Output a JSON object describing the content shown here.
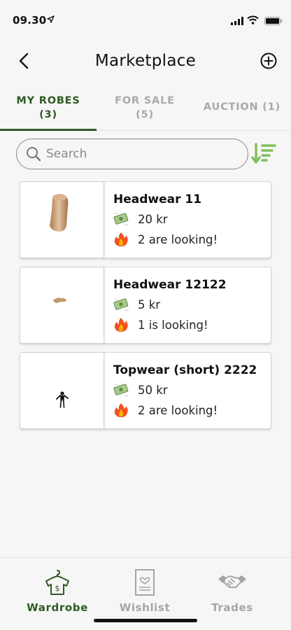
{
  "status": {
    "time": "09.30"
  },
  "header": {
    "title": "Marketplace"
  },
  "tabs": [
    {
      "label": "MY ROBES",
      "count": "(3)"
    },
    {
      "label": "FOR SALE",
      "count": "(5)"
    },
    {
      "label": "AUCTION (1)"
    }
  ],
  "search": {
    "placeholder": "Search",
    "value": ""
  },
  "items": [
    {
      "name": "Headwear 11",
      "price": "20 kr",
      "looking": "2 are looking!"
    },
    {
      "name": "Headwear 12122",
      "price": "5 kr",
      "looking": "1 is looking!"
    },
    {
      "name": "Topwear (short) 2222",
      "price": "50 kr",
      "looking": "2 are looking!"
    }
  ],
  "bottom_nav": [
    {
      "label": "Wardrobe",
      "icon": "hanger-shirt-icon"
    },
    {
      "label": "Wishlist",
      "icon": "wishlist-paper-icon"
    },
    {
      "label": "Trades",
      "icon": "handshake-icon"
    }
  ],
  "colors": {
    "accent": "#2f5a25",
    "sort_icon": "#7fbf5a",
    "inactive": "#a9a9a9"
  }
}
